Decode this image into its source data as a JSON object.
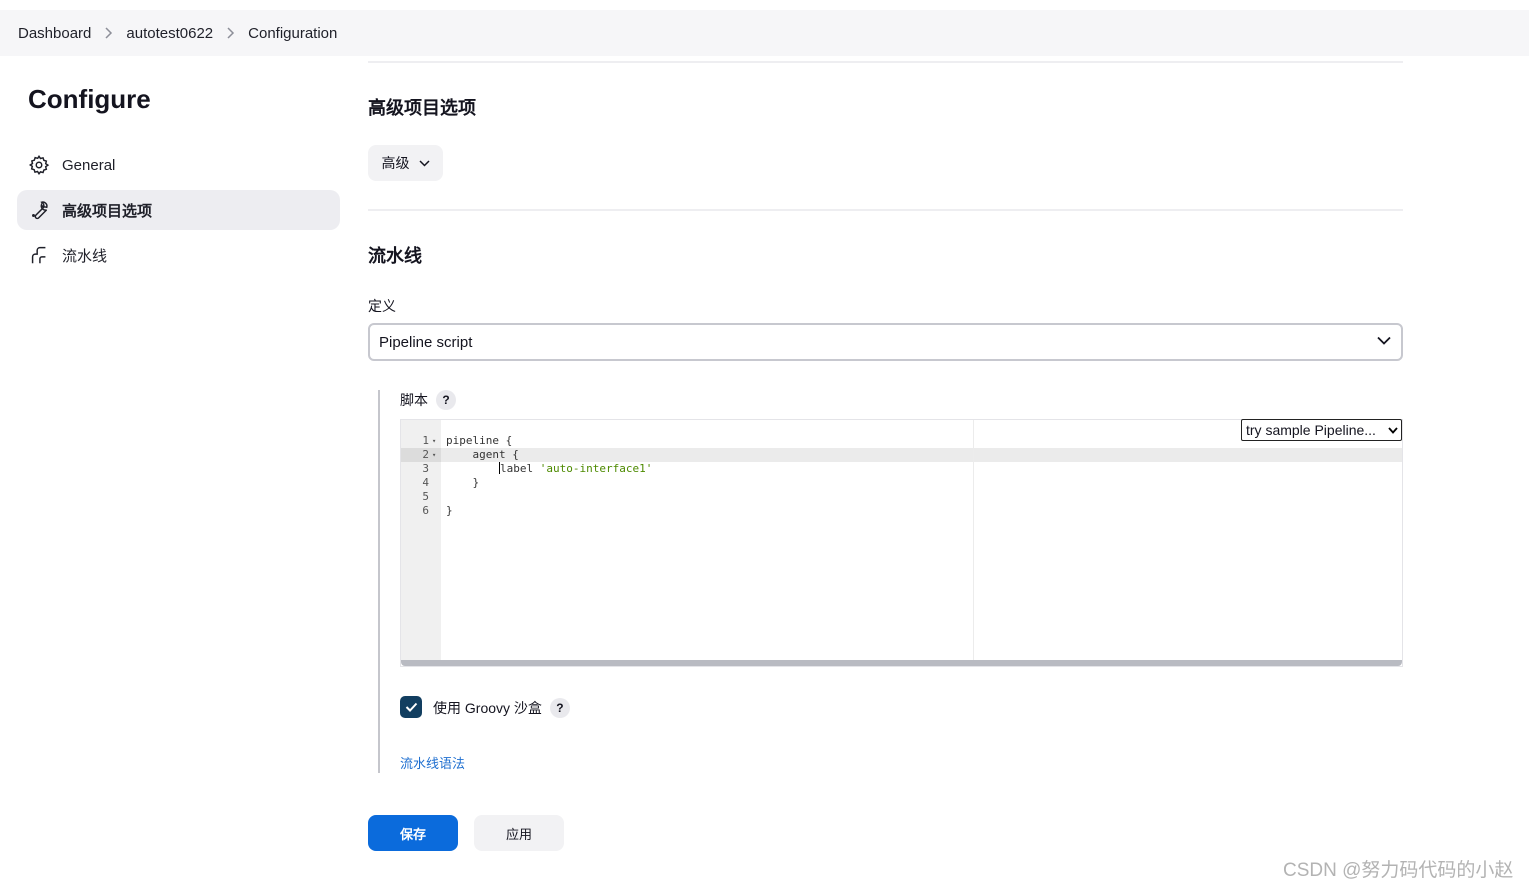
{
  "breadcrumb": {
    "items": [
      "Dashboard",
      "autotest0622",
      "Configuration"
    ]
  },
  "sidebar": {
    "title": "Configure",
    "items": [
      {
        "label": "General",
        "icon": "gear-icon"
      },
      {
        "label": "高级项目选项",
        "icon": "wrench-icon",
        "active": true
      },
      {
        "label": "流水线",
        "icon": "pipeline-icon"
      }
    ]
  },
  "advanced": {
    "title": "高级项目选项",
    "button_label": "高级"
  },
  "pipeline": {
    "title": "流水线",
    "definition_label": "定义",
    "definition_value": "Pipeline script",
    "script_label": "脚本",
    "help_label": "?",
    "sample_select": "try sample Pipeline...",
    "code_lines": [
      {
        "num": "1",
        "fold": "▾",
        "text": "pipeline {"
      },
      {
        "num": "2",
        "fold": "▾",
        "text": "    agent {"
      },
      {
        "num": "3",
        "fold": "",
        "text_before": "        ",
        "keyword": "label ",
        "string": "'auto-interface1'"
      },
      {
        "num": "4",
        "fold": "",
        "text": "    }"
      },
      {
        "num": "5",
        "fold": "",
        "text": ""
      },
      {
        "num": "6",
        "fold": "",
        "text": "}"
      }
    ],
    "groovy_sandbox_label": "使用 Groovy 沙盒",
    "groovy_sandbox_checked": true,
    "syntax_link": "流水线语法"
  },
  "actions": {
    "save_label": "保存",
    "apply_label": "应用"
  },
  "watermark": "CSDN @努力码代码的小赵",
  "colors": {
    "primary_button": "#0b6bdc",
    "checkbox": "#123e60",
    "link": "#1f6fd0",
    "string_literal": "#4d8a00"
  }
}
